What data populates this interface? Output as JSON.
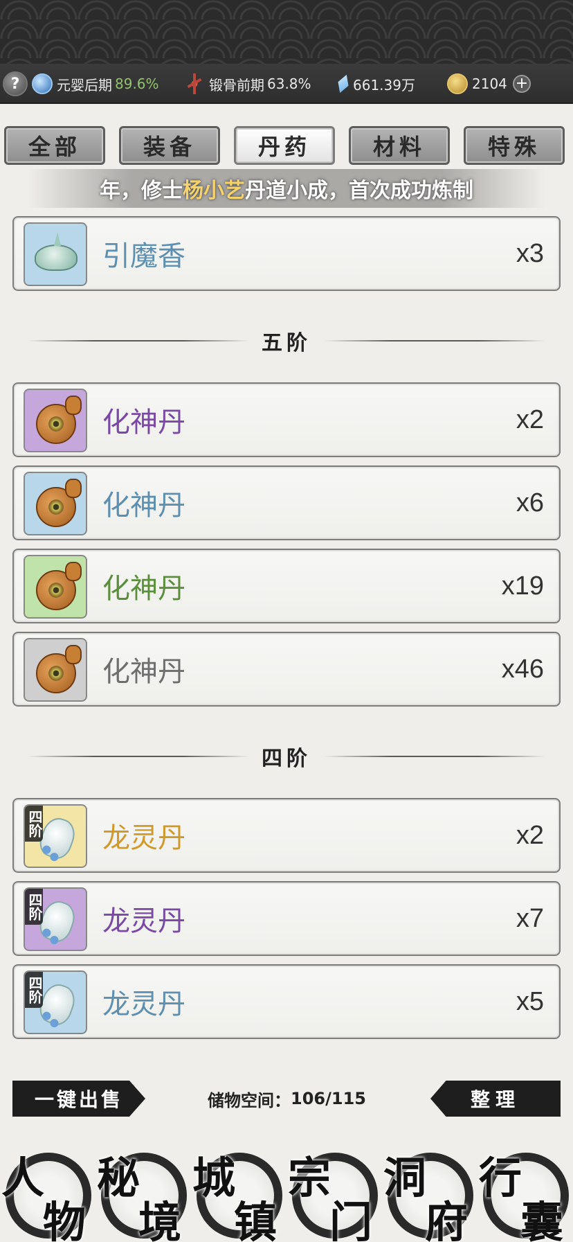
{
  "status": {
    "help_label": "?",
    "realm_label": "元婴后期",
    "realm_pct": "89.6%",
    "body_label": "锻骨前期",
    "body_pct": "63.8%",
    "spirit_stones": "661.39万",
    "gold": "2104",
    "plus_label": "+"
  },
  "tabs": [
    {
      "label": "全部",
      "active": false
    },
    {
      "label": "装备",
      "active": false
    },
    {
      "label": "丹药",
      "active": true
    },
    {
      "label": "材料",
      "active": false
    },
    {
      "label": "特殊",
      "active": false
    }
  ],
  "marquee": {
    "pre": "年，修士",
    "name": "杨小艺",
    "post": "丹道小成，首次成功炼制"
  },
  "items": [
    {
      "name": "引魔香",
      "qty": "x3",
      "rarity": "blue",
      "icon": "incense-burner-icon"
    },
    {
      "name": "化神丹",
      "qty": "x2",
      "rarity": "purple",
      "icon": "gourd-icon"
    },
    {
      "name": "化神丹",
      "qty": "x6",
      "rarity": "blue",
      "icon": "gourd-icon"
    },
    {
      "name": "化神丹",
      "qty": "x19",
      "rarity": "green",
      "icon": "gourd-icon"
    },
    {
      "name": "化神丹",
      "qty": "x46",
      "rarity": "gray",
      "icon": "gourd-icon"
    },
    {
      "name": "龙灵丹",
      "qty": "x2",
      "rarity": "gold",
      "icon": "vase-icon",
      "tier_tag": "四阶"
    },
    {
      "name": "龙灵丹",
      "qty": "x7",
      "rarity": "purple",
      "icon": "vase-icon",
      "tier_tag": "四阶"
    },
    {
      "name": "龙灵丹",
      "qty": "x5",
      "rarity": "blue",
      "icon": "vase-icon",
      "tier_tag": "四阶"
    }
  ],
  "dividers": [
    "五阶",
    "四阶"
  ],
  "footer": {
    "sell_all": "一键出售",
    "storage_label": "储物空间：",
    "storage_value": "106/115",
    "sort": "整理"
  },
  "nav": [
    {
      "c1": "人",
      "c2": "物"
    },
    {
      "c1": "秘",
      "c2": "境"
    },
    {
      "c1": "城",
      "c2": "镇"
    },
    {
      "c1": "宗",
      "c2": "门"
    },
    {
      "c1": "洞",
      "c2": "府"
    },
    {
      "c1": "行",
      "c2": "囊"
    }
  ],
  "colors": {
    "blue": "#5d8fb0",
    "purple": "#7a49a6",
    "green": "#5b8f3c",
    "gray": "#6e6e6e",
    "gold": "#d09a2a"
  }
}
